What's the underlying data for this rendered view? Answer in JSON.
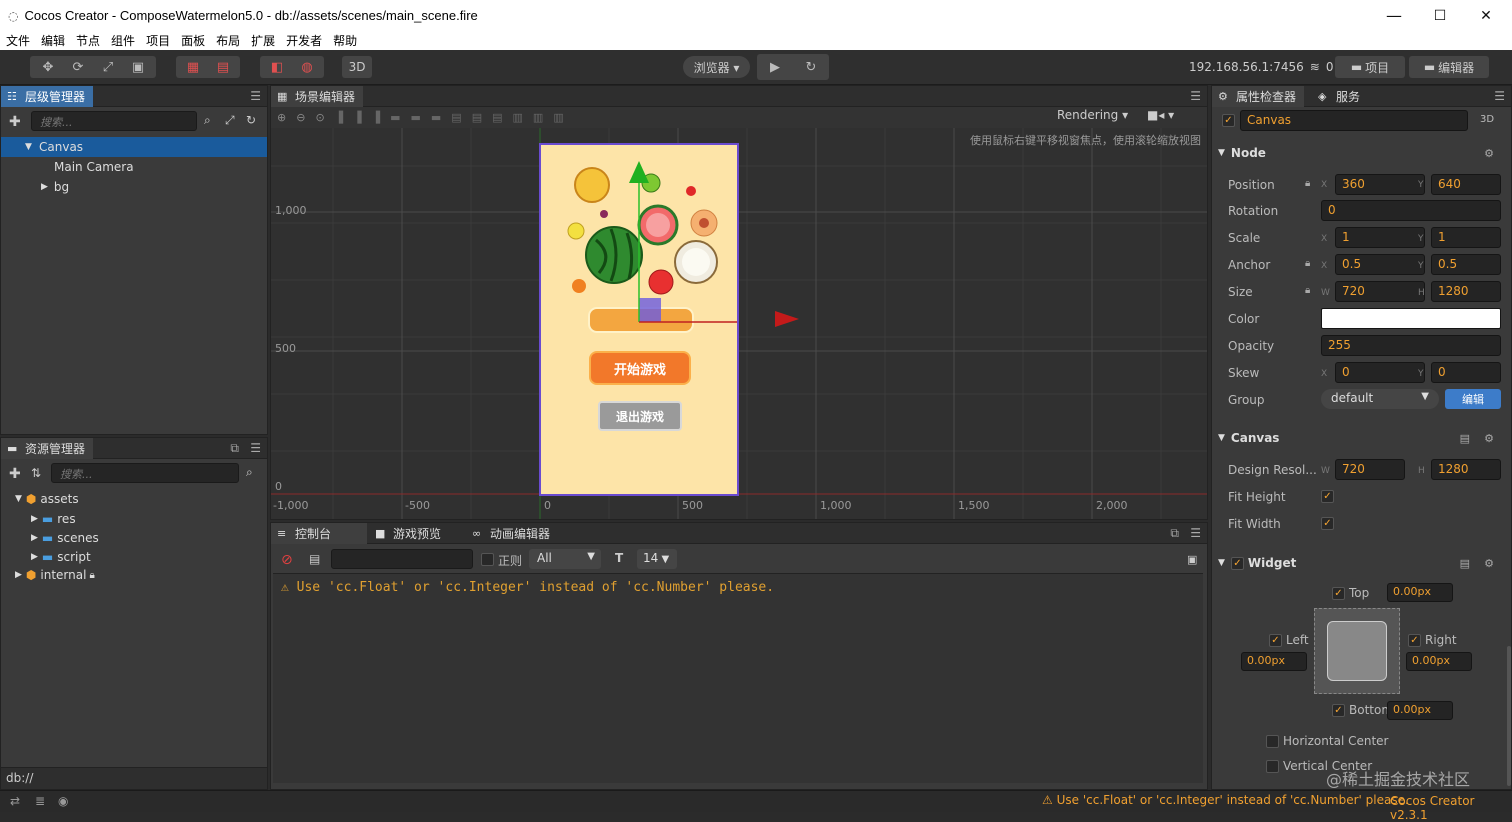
{
  "window": {
    "title": "Cocos Creator - ComposeWatermelon5.0 - db://assets/scenes/main_scene.fire",
    "minimize": "—",
    "maximize": "☐",
    "close": "✕"
  },
  "menu": [
    "文件",
    "编辑",
    "节点",
    "组件",
    "项目",
    "面板",
    "布局",
    "扩展",
    "开发者",
    "帮助"
  ],
  "toolbar": {
    "btn3d": "3D",
    "browser": "浏览器 ▾",
    "ip": "192.168.56.1:7456",
    "count": "0",
    "project": "项目",
    "editor": "编辑器"
  },
  "hierarchy": {
    "tab": "层级管理器",
    "search_placeholder": "搜索...",
    "items": [
      {
        "label": "Canvas"
      },
      {
        "label": "Main Camera"
      },
      {
        "label": "bg"
      }
    ]
  },
  "assets": {
    "tab": "资源管理器",
    "search_placeholder": "搜索...",
    "items": [
      {
        "label": "assets"
      },
      {
        "label": "res"
      },
      {
        "label": "scenes"
      },
      {
        "label": "script"
      },
      {
        "label": "internal"
      }
    ],
    "path": "db://"
  },
  "scene": {
    "tab": "场景编辑器",
    "rendering": "Rendering",
    "hint": "使用鼠标右键平移视窗焦点，使用滚轮缩放视图",
    "y_labels": [
      "1,000",
      "500",
      "0"
    ],
    "x_labels": [
      "-1,000",
      "-500",
      "0",
      "500",
      "1,000",
      "1,500",
      "2,000"
    ],
    "start_btn": "开始游戏",
    "exit_btn": "退出游戏"
  },
  "console": {
    "tabs": [
      "控制台",
      "游戏预览",
      "动画编辑器"
    ],
    "regex": "正则",
    "filter": "All",
    "fontsize": "14",
    "message": "Use 'cc.Float' or 'cc.Integer' instead of 'cc.Number' please."
  },
  "inspector": {
    "tabs": [
      "属性检查器",
      "服务"
    ],
    "node_name": "Canvas",
    "btn3d": "3D",
    "node_section": "Node",
    "position_label": "Position",
    "pos_x": "360",
    "pos_y": "640",
    "rotation_label": "Rotation",
    "rotation": "0",
    "scale_label": "Scale",
    "scale_x": "1",
    "scale_y": "1",
    "anchor_label": "Anchor",
    "anchor_x": "0.5",
    "anchor_y": "0.5",
    "size_label": "Size",
    "size_w": "720",
    "size_h": "1280",
    "color_label": "Color",
    "color_value": "#ffffff",
    "opacity_label": "Opacity",
    "opacity": "255",
    "skew_label": "Skew",
    "skew_x": "0",
    "skew_y": "0",
    "group_label": "Group",
    "group": "default",
    "edit": "编辑",
    "canvas_section": "Canvas",
    "design_label": "Design Resol...",
    "design_w": "720",
    "design_h": "1280",
    "fit_height": "Fit Height",
    "fit_width": "Fit Width",
    "widget_section": "Widget",
    "top": "Top",
    "top_val": "0.00px",
    "left": "Left",
    "left_val": "0.00px",
    "right": "Right",
    "right_val": "0.00px",
    "bottom": "Bottom",
    "bottom_val": "0.00px",
    "hcenter": "Horizontal Center",
    "vcenter": "Vertical Center",
    "axis_x": "X",
    "axis_y": "Y",
    "axis_w": "W",
    "axis_h": "H"
  },
  "status": {
    "warning": "Use 'cc.Float' or 'cc.Integer' instead of 'cc.Number' please.",
    "version": "Cocos Creator v2.3.1",
    "watermark": "@稀土掘金技术社区"
  },
  "colors": {
    "accent": "#f0a030",
    "selection": "#1a5b9c",
    "scene_bg": "#303030",
    "game_bg": "#fde4a8"
  }
}
